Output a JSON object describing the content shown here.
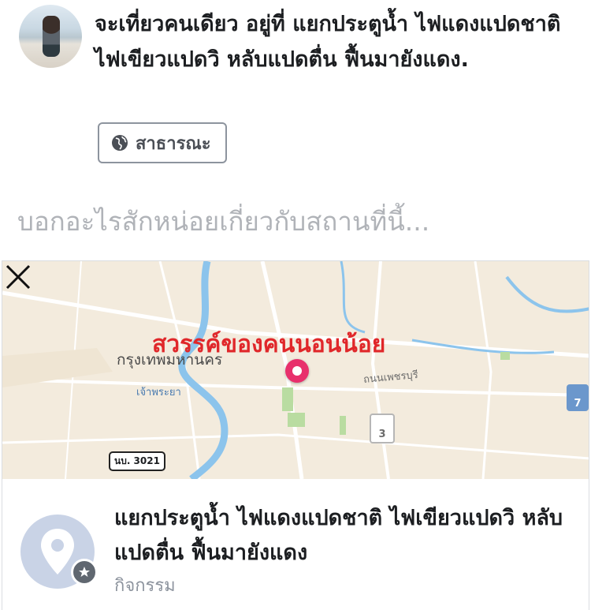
{
  "post": {
    "status_text": "จะเที่ยวคนเดียว อยู่ที่ แยกประตูน้ำ ไฟแดงแปดชาติ ไฟเขียวแปดวิ หลับแปดตื่น ฟื้นมายังแดง.",
    "privacy_label": "สาธารณะ",
    "place_prompt_placeholder": "บอกอะไรสักหน่อยเกี่ยวกับสถานที่นี้..."
  },
  "map": {
    "overlay_title": "สวรรค์ของคนนอนน้อย",
    "labels": {
      "bangkok": "กรุงเทพมหานคร",
      "chao_phraya": "เจ้าพระยา",
      "road_sign": "นบ. 3021",
      "petchburi_road": "ถนนเพชรบุรี",
      "route_3": "3",
      "route_7": "7"
    },
    "pin_color": "#e8306c",
    "title_color": "#e0272a"
  },
  "place": {
    "name": "แยกประตูน้ำ ไฟแดงแปดชาติ ไฟเขียวแปดวิ หลับแปดตื่น ฟื้นมายังแดง",
    "category": "กิจกรรม"
  }
}
